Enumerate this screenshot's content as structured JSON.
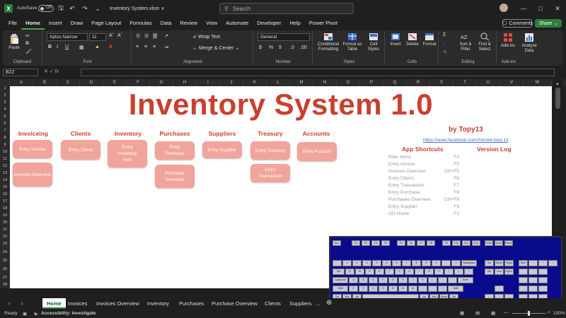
{
  "titlebar": {
    "autosave_label": "AutoSave",
    "autosave_state": "Off",
    "doc_title": "Inventory System.xlsm ∨",
    "search_placeholder": "Search"
  },
  "menu": [
    "File",
    "Home",
    "Insert",
    "Draw",
    "Page Layout",
    "Formulas",
    "Data",
    "Review",
    "View",
    "Automate",
    "Developer",
    "Help",
    "Power Pivot"
  ],
  "menu_active": "Home",
  "comments_label": "Comments",
  "share_label": "Share",
  "ribbon": {
    "clipboard": {
      "paste": "Paste",
      "label": "Clipboard"
    },
    "font": {
      "name": "Aptos Narrow",
      "size": "11",
      "label": "Font"
    },
    "alignment": {
      "wrap": "Wrap Text",
      "merge": "Merge & Center",
      "label": "Alignment"
    },
    "number": {
      "format": "General",
      "label": "Number"
    },
    "styles": {
      "conditional": "Conditional Formatting",
      "format_table": "Format as Table",
      "cell_styles": "Cell Styles",
      "label": "Styles"
    },
    "cells": {
      "insert": "Insert",
      "delete": "Delete",
      "format": "Format",
      "label": "Cells"
    },
    "editing": {
      "sort": "Sort & Filter",
      "find": "Find & Select",
      "label": "Editing"
    },
    "addins": {
      "addins": "Add-ins",
      "analyze": "Analyze Data",
      "label": "Add-ins"
    }
  },
  "namebox": "B22",
  "fx_label": "fx",
  "columns": [
    "A",
    "B",
    "C",
    "D",
    "E",
    "F",
    "G",
    "H",
    "I",
    "J",
    "K",
    "L",
    "M",
    "N",
    "O",
    "P",
    "Q",
    "R",
    "S",
    "T",
    "U",
    "V",
    "W"
  ],
  "rows": [
    "1",
    "2",
    "3",
    "4",
    "5",
    "6",
    "7",
    "8",
    "9",
    "10",
    "11",
    "12",
    "13",
    "14",
    "15",
    "16",
    "17",
    "18",
    "19",
    "20",
    "21",
    "22",
    "23",
    "24",
    "25",
    "26",
    "27",
    "28"
  ],
  "sheet": {
    "title": "Inventory System 1.0",
    "byline": "by Topy13",
    "fb_link": "https://www.facebook.com/Ahmed.topy.13",
    "sections": [
      {
        "heading": "Invoiceing",
        "buttons": [
          "Entry Invoice",
          "Invoices Overview"
        ]
      },
      {
        "heading": "Clients",
        "buttons": [
          "Entry Client"
        ]
      },
      {
        "heading": "Inventory",
        "buttons": [
          "Entry Inventory Item"
        ]
      },
      {
        "heading": "Purchases",
        "buttons": [
          "Entry Purchase",
          "Purchase Overview"
        ]
      },
      {
        "heading": "Suppliers",
        "buttons": [
          "Entry Supplier"
        ]
      },
      {
        "heading": "Treasury",
        "buttons": [
          "Entry Treasury",
          "Entry Transaction"
        ]
      },
      {
        "heading": "Accounts",
        "buttons": [
          "Entry Account"
        ]
      }
    ],
    "shortcuts_title": "App Shortcuts",
    "version_title": "Version Log",
    "shortcuts": [
      {
        "name": "Filter Items",
        "key": "F3"
      },
      {
        "name": "Entry Invoice",
        "key": "F5"
      },
      {
        "name": "Invoices Overview",
        "key": "Ctrl+F5"
      },
      {
        "name": "Entry Cliems",
        "key": "F6"
      },
      {
        "name": "Entry Transaction",
        "key": "F7"
      },
      {
        "name": "Entry Purchase",
        "key": "F8"
      },
      {
        "name": "Purchases Overview",
        "key": "Ctrl+F8"
      },
      {
        "name": "Entry Supplier",
        "key": "F9"
      },
      {
        "name": "GO Home",
        "key": "F1"
      }
    ]
  },
  "tabs": [
    "Home",
    "Invoices",
    "Invoices Overview",
    "Inventory",
    "Purchases",
    "Purchase Overview",
    "Clients",
    "Suppliers"
  ],
  "tabs_more": "...",
  "status": {
    "ready": "Ready",
    "accessibility": "Accessibility: Investigate",
    "zoom": "100%"
  },
  "keyboard": {
    "fn_row": [
      "Esc",
      "F1",
      "F2",
      "F3",
      "F4",
      "F5",
      "F6",
      "F7",
      "F8",
      "F9",
      "F10",
      "F11",
      "F12",
      "PrtScr",
      "ScrLk",
      "Pause"
    ],
    "row1": [
      "`",
      "1",
      "2",
      "3",
      "4",
      "5",
      "6",
      "7",
      "8",
      "9",
      "0",
      "-",
      "=",
      "Backspace"
    ],
    "row2": [
      "Tab",
      "Q",
      "W",
      "E",
      "R",
      "T",
      "Y",
      "U",
      "I",
      "O",
      "P",
      "[",
      "]",
      "\\"
    ],
    "row3": [
      "CapsLock",
      "A",
      "S",
      "D",
      "F",
      "G",
      "H",
      "J",
      "K",
      "L",
      ";",
      "'",
      "Enter"
    ],
    "row4": [
      "Shift",
      "Z",
      "X",
      "C",
      "V",
      "B",
      "N",
      "M",
      ",",
      ".",
      "/",
      "Shift"
    ],
    "row5": [
      "Ctrl",
      "Win",
      "Alt",
      "",
      "Alt",
      "Win",
      "Menu",
      "Ctrl"
    ],
    "nav": [
      "Ins",
      "Home",
      "PgUp",
      "Del",
      "End",
      "PgDn"
    ],
    "numpad_top": [
      "Num",
      "/",
      "*",
      "-"
    ]
  }
}
